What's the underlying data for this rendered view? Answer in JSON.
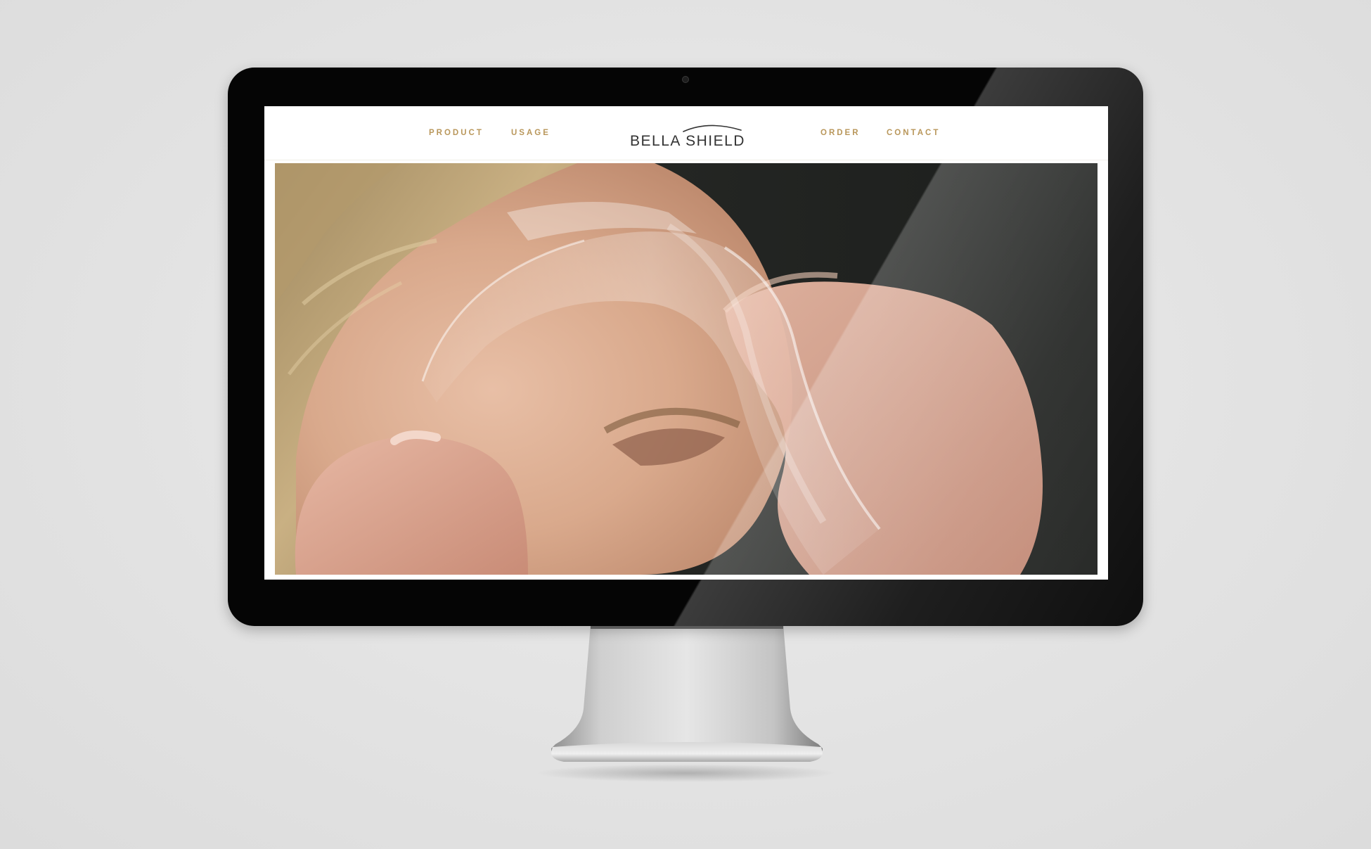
{
  "site": {
    "brand": "BELLA SHIELD",
    "nav_left": [
      "PRODUCT",
      "USAGE"
    ],
    "nav_right": [
      "ORDER",
      "CONTACT"
    ],
    "accent_color": "#b9975b",
    "brand_color": "#333333"
  },
  "hero": {
    "icon": "hero-photo-face-shield"
  },
  "device": {
    "type": "desktop-monitor",
    "bezel_color": "#050505",
    "stand_color": "#c8c8c8"
  }
}
